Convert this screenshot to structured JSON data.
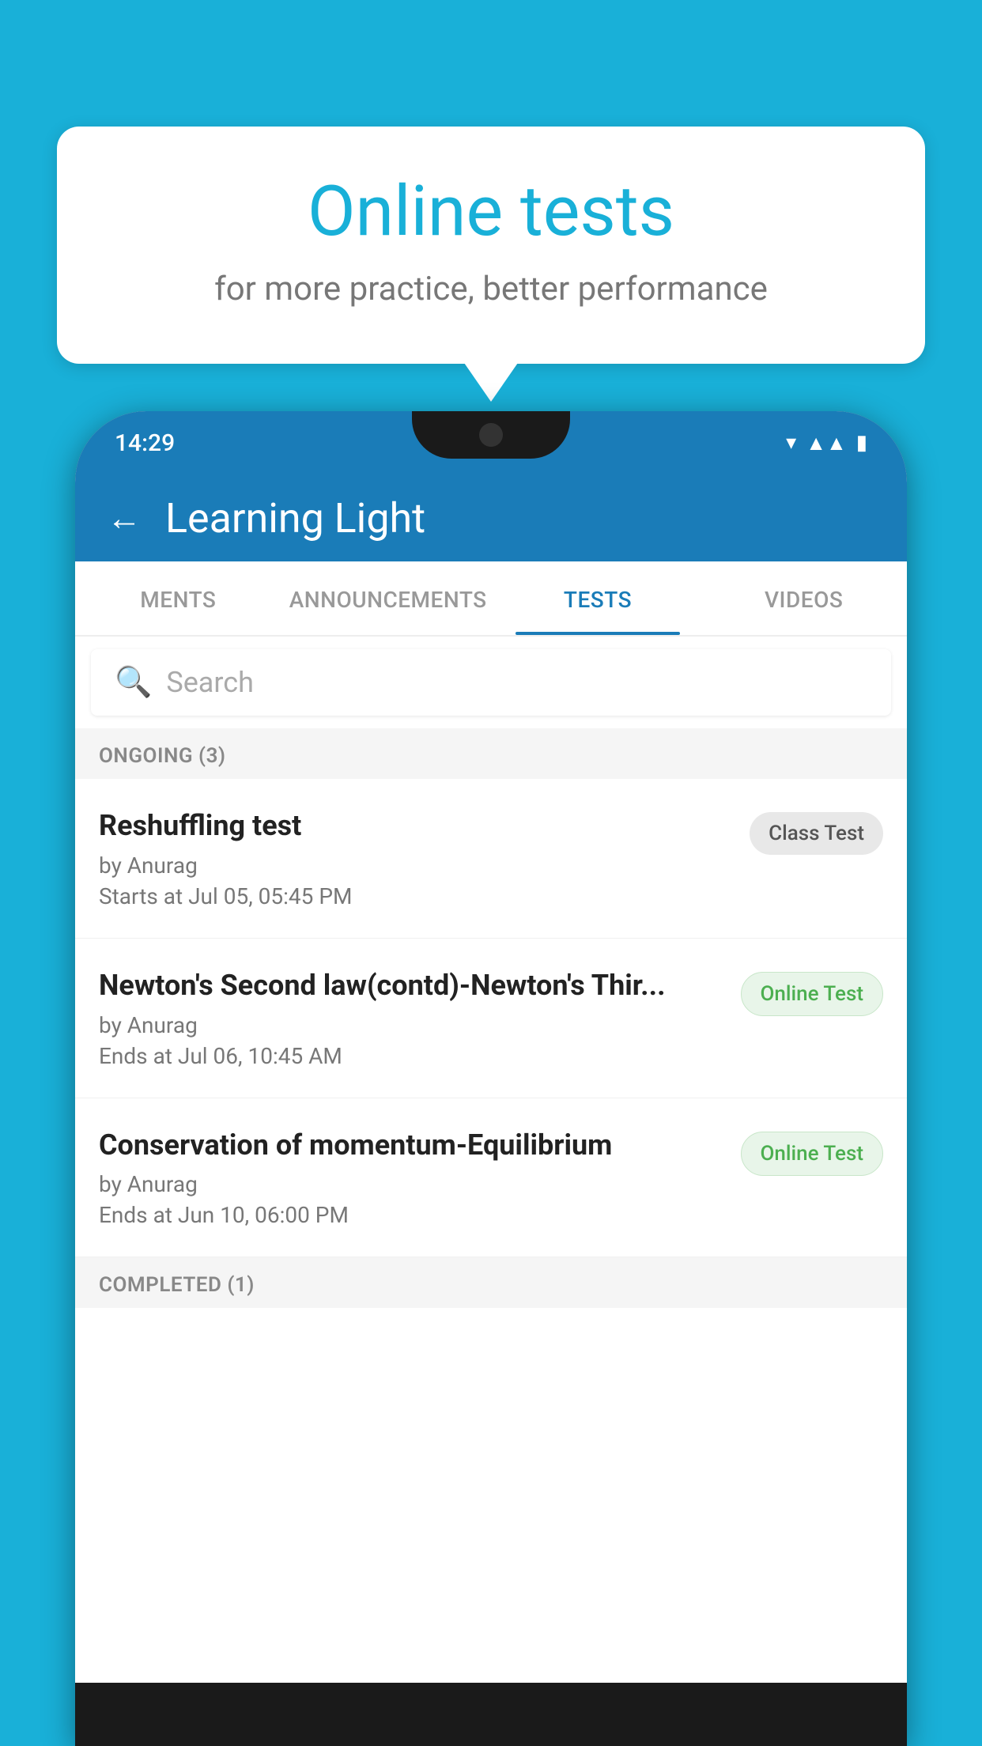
{
  "background_color": "#19b0d8",
  "bubble": {
    "title": "Online tests",
    "subtitle": "for more practice, better performance"
  },
  "phone": {
    "status_bar": {
      "time": "14:29",
      "icons": [
        "wifi",
        "signal",
        "battery"
      ]
    },
    "header": {
      "title": "Learning Light",
      "back_label": "←"
    },
    "tabs": [
      {
        "label": "MENTS",
        "active": false
      },
      {
        "label": "ANNOUNCEMENTS",
        "active": false
      },
      {
        "label": "TESTS",
        "active": true
      },
      {
        "label": "VIDEOS",
        "active": false
      }
    ],
    "search": {
      "placeholder": "Search"
    },
    "ongoing_section": {
      "label": "ONGOING (3)"
    },
    "tests": [
      {
        "title": "Reshuffling test",
        "author": "by Anurag",
        "date": "Starts at  Jul 05, 05:45 PM",
        "badge": "Class Test",
        "badge_type": "class"
      },
      {
        "title": "Newton's Second law(contd)-Newton's Thir...",
        "author": "by Anurag",
        "date": "Ends at  Jul 06, 10:45 AM",
        "badge": "Online Test",
        "badge_type": "online"
      },
      {
        "title": "Conservation of momentum-Equilibrium",
        "author": "by Anurag",
        "date": "Ends at  Jun 10, 06:00 PM",
        "badge": "Online Test",
        "badge_type": "online"
      }
    ],
    "completed_section": {
      "label": "COMPLETED (1)"
    }
  }
}
